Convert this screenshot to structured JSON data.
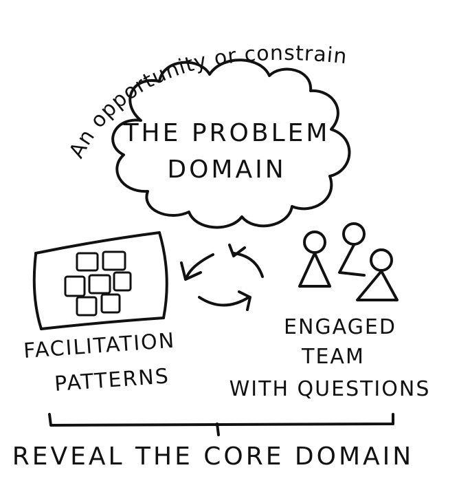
{
  "curved_caption": "An opportunity or constraint",
  "cloud": {
    "line1": "THE PROBLEM",
    "line2": "DOMAIN"
  },
  "facilitation": {
    "line1": "FACILITATION",
    "line2": "PATTERNS"
  },
  "team": {
    "line1": "ENGAGED",
    "line2": "TEAM",
    "line3": "WITH QUESTIONS"
  },
  "conclusion": "REVEAL THE CORE DOMAIN",
  "icons": [
    "cloud-shape",
    "sticky-notes-board-icon",
    "cycle-arrows-icon",
    "people-group-icon",
    "bracket-icon"
  ]
}
